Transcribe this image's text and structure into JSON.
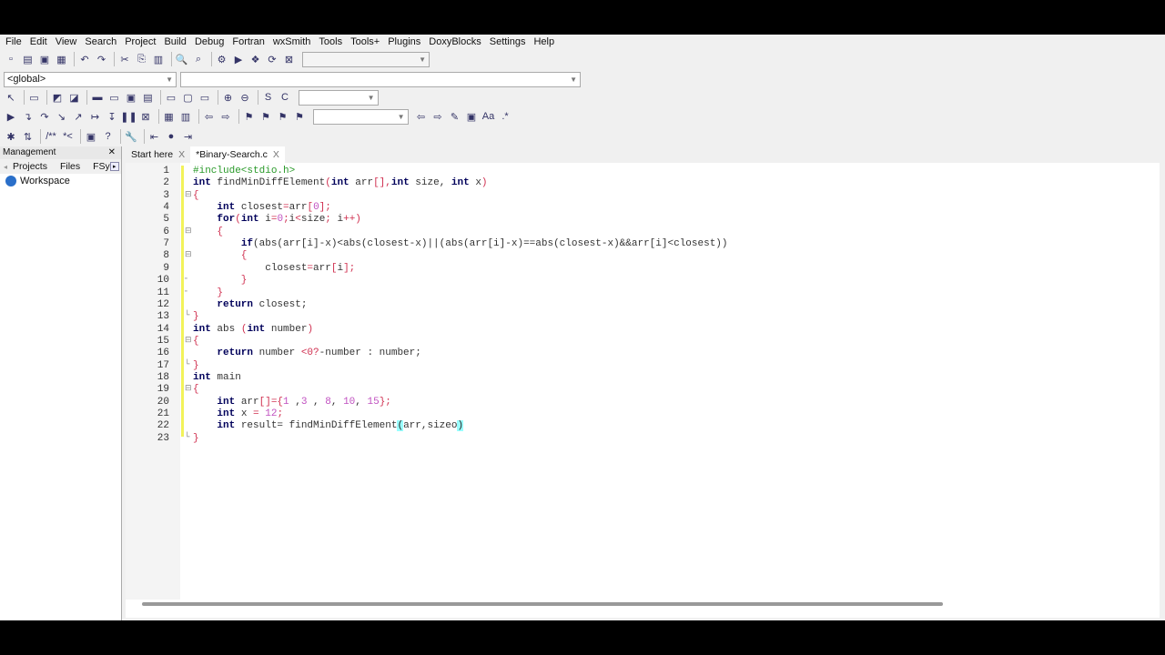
{
  "menu": [
    "File",
    "Edit",
    "View",
    "Search",
    "Project",
    "Build",
    "Debug",
    "Fortran",
    "wxSmith",
    "Tools",
    "Tools+",
    "Plugins",
    "DoxyBlocks",
    "Settings",
    "Help"
  ],
  "toolbar1": [
    [
      "new-file",
      "▫"
    ],
    [
      "open",
      "▤"
    ],
    [
      "save",
      "▣"
    ],
    [
      "save-all",
      "▦"
    ],
    [
      "sep",
      ""
    ],
    [
      "undo",
      "↶"
    ],
    [
      "redo",
      "↷"
    ],
    [
      "sep",
      ""
    ],
    [
      "cut",
      "✂"
    ],
    [
      "copy",
      "⎘"
    ],
    [
      "paste",
      "▥"
    ],
    [
      "sep",
      ""
    ],
    [
      "find",
      "🔍"
    ],
    [
      "replace",
      "⌕"
    ],
    [
      "sep",
      ""
    ],
    [
      "build",
      "⚙"
    ],
    [
      "run",
      "▶"
    ],
    [
      "build-run",
      "❖"
    ],
    [
      "rebuild",
      "⟳"
    ],
    [
      "abort",
      "⊠"
    ]
  ],
  "scope_combo": "<global>",
  "toolbar3": [
    [
      "pointer",
      "↖"
    ],
    [
      "sep",
      ""
    ],
    [
      "frame",
      "▭"
    ],
    [
      "sep",
      ""
    ],
    [
      "widget1",
      "◩"
    ],
    [
      "widget2",
      "◪"
    ],
    [
      "sep",
      ""
    ],
    [
      "panel1",
      "▬"
    ],
    [
      "panel2",
      "▭"
    ],
    [
      "panel3",
      "▣"
    ],
    [
      "panel4",
      "▤"
    ],
    [
      "sep",
      ""
    ],
    [
      "box1",
      "▭"
    ],
    [
      "box2",
      "▢"
    ],
    [
      "box3",
      "▭"
    ],
    [
      "sep",
      ""
    ],
    [
      "zoom-in",
      "⊕"
    ],
    [
      "zoom-out",
      "⊖"
    ],
    [
      "sep",
      ""
    ],
    [
      "s",
      "S"
    ],
    [
      "c",
      "C"
    ]
  ],
  "toolbar4": [
    [
      "debug-run",
      "▶"
    ],
    [
      "run-to-cursor",
      "↴"
    ],
    [
      "next-line",
      "↷"
    ],
    [
      "step-into",
      "↘"
    ],
    [
      "step-out",
      "↗"
    ],
    [
      "next-instruction",
      "↦"
    ],
    [
      "step-instruction",
      "↧"
    ],
    [
      "pause",
      "❚❚"
    ],
    [
      "stop",
      "⊠"
    ],
    [
      "sep",
      ""
    ],
    [
      "debug-windows",
      "▦"
    ],
    [
      "info",
      "▥"
    ],
    [
      "sep",
      ""
    ],
    [
      "back",
      "⇦"
    ],
    [
      "forward",
      "⇨"
    ],
    [
      "sep",
      ""
    ],
    [
      "bookmark-toggle",
      "⚑"
    ],
    [
      "bookmark-prev",
      "⚑"
    ],
    [
      "bookmark-next",
      "⚑"
    ],
    [
      "bookmark-clear",
      "⚑"
    ]
  ],
  "toolbar4b": [
    [
      "prev",
      "⇦"
    ],
    [
      "next",
      "⇨"
    ],
    [
      "highlight",
      "✎"
    ],
    [
      "selected",
      "▣"
    ],
    [
      "match-case",
      "Aa"
    ],
    [
      "regex",
      ".*"
    ]
  ],
  "toolbar5": [
    [
      "doxy1",
      "✱"
    ],
    [
      "doxy2",
      "⇅"
    ],
    [
      "sep",
      ""
    ],
    [
      "comment-block",
      "/**"
    ],
    [
      "comment-line",
      "*<"
    ],
    [
      "sep",
      ""
    ],
    [
      "html",
      "▣"
    ],
    [
      "chm",
      "?"
    ],
    [
      "sep",
      ""
    ],
    [
      "config",
      "🔧"
    ],
    [
      "sep",
      ""
    ],
    [
      "jump-back",
      "⇤"
    ],
    [
      "jump-home",
      "●"
    ],
    [
      "jump-fwd",
      "⇥"
    ]
  ],
  "management": {
    "title": "Management",
    "tabs": [
      "Projects",
      "Files",
      "FSy"
    ],
    "workspace": "Workspace"
  },
  "editor_tabs": [
    {
      "label": "Start here",
      "close": "X"
    },
    {
      "label": "*Binary-Search.c",
      "close": "X"
    }
  ],
  "code": [
    [
      [
        "#include<stdio.h>",
        "p"
      ]
    ],
    [
      [
        "int",
        "k"
      ],
      [
        " findMinDiffElement",
        "t"
      ],
      [
        "(",
        "o"
      ],
      [
        "int",
        "k"
      ],
      [
        " arr",
        "t"
      ],
      [
        "[]",
        "o"
      ],
      [
        ",",
        "o"
      ],
      [
        "int",
        "k"
      ],
      [
        " size, ",
        "t"
      ],
      [
        "int",
        "k"
      ],
      [
        " x",
        "t"
      ],
      [
        ")",
        "o"
      ]
    ],
    [
      [
        "{",
        "o"
      ]
    ],
    [
      [
        "    ",
        "t"
      ],
      [
        "int",
        "k"
      ],
      [
        " closest",
        "t"
      ],
      [
        "=",
        "o"
      ],
      [
        "arr",
        "t"
      ],
      [
        "[",
        "o"
      ],
      [
        "0",
        "n"
      ],
      [
        "];",
        "o"
      ]
    ],
    [
      [
        "    ",
        "t"
      ],
      [
        "for",
        "k"
      ],
      [
        "(",
        "o"
      ],
      [
        "int",
        "k"
      ],
      [
        " i",
        "t"
      ],
      [
        "=",
        "o"
      ],
      [
        "0",
        "n"
      ],
      [
        ";",
        "o"
      ],
      [
        "i",
        "t"
      ],
      [
        "<",
        "o"
      ],
      [
        "size",
        "t"
      ],
      [
        ";",
        "o"
      ],
      [
        " i",
        "t"
      ],
      [
        "++)",
        "o"
      ]
    ],
    [
      [
        "    {",
        "o"
      ]
    ],
    [
      [
        "        ",
        "t"
      ],
      [
        "if",
        "k"
      ],
      [
        "(abs(arr[i]-x)<abs(closest-x)||(abs(arr[i]-x)==abs(closest-x)&&arr[i]<closest))",
        "t"
      ]
    ],
    [
      [
        "        {",
        "o"
      ]
    ],
    [
      [
        "            closest",
        "t"
      ],
      [
        "=",
        "o"
      ],
      [
        "arr",
        "t"
      ],
      [
        "[",
        "o"
      ],
      [
        "i",
        "t"
      ],
      [
        "];",
        "o"
      ]
    ],
    [
      [
        "        }",
        "o"
      ]
    ],
    [
      [
        "    }",
        "o"
      ]
    ],
    [
      [
        "    ",
        "t"
      ],
      [
        "return",
        "k"
      ],
      [
        " closest;",
        "t"
      ]
    ],
    [
      [
        "}",
        "o"
      ]
    ],
    [
      [
        "int",
        "k"
      ],
      [
        " abs ",
        "t"
      ],
      [
        "(",
        "o"
      ],
      [
        "int",
        "k"
      ],
      [
        " number",
        "t"
      ],
      [
        ")",
        "o"
      ]
    ],
    [
      [
        "{",
        "o"
      ]
    ],
    [
      [
        "    ",
        "t"
      ],
      [
        "return",
        "k"
      ],
      [
        " number ",
        "t"
      ],
      [
        "<0?",
        "o"
      ],
      [
        "-number : number;",
        "t"
      ]
    ],
    [
      [
        "}",
        "o"
      ]
    ],
    [
      [
        "int",
        "k"
      ],
      [
        " main",
        "t"
      ]
    ],
    [
      [
        "{",
        "o"
      ]
    ],
    [
      [
        "    ",
        "t"
      ],
      [
        "int",
        "k"
      ],
      [
        " arr",
        "t"
      ],
      [
        "[]={",
        "o"
      ],
      [
        "1",
        "n"
      ],
      [
        " ,",
        "t"
      ],
      [
        "3",
        "n"
      ],
      [
        " , ",
        "t"
      ],
      [
        "8",
        "n"
      ],
      [
        ", ",
        "t"
      ],
      [
        "10",
        "n"
      ],
      [
        ", ",
        "t"
      ],
      [
        "15",
        "n"
      ],
      [
        "};",
        "o"
      ]
    ],
    [
      [
        "    ",
        "t"
      ],
      [
        "int",
        "k"
      ],
      [
        " x ",
        "t"
      ],
      [
        "=",
        "o"
      ],
      [
        " ",
        "t"
      ],
      [
        "12",
        "n"
      ],
      [
        ";",
        "o"
      ]
    ],
    [
      [
        "    ",
        "t"
      ],
      [
        "int",
        "k"
      ],
      [
        " result= findMinDiffElement",
        "t"
      ],
      [
        "(",
        "hl"
      ],
      [
        "arr,sizeo",
        "t"
      ],
      [
        ")",
        "hl"
      ]
    ],
    [
      [
        "}",
        "o"
      ]
    ]
  ],
  "fold_markers": {
    "3": "⊟",
    "6": "⊟",
    "8": "⊟",
    "10": "╴",
    "11": "╴",
    "13": "└",
    "15": "⊟",
    "17": "└",
    "19": "⊟",
    "23": "└"
  }
}
